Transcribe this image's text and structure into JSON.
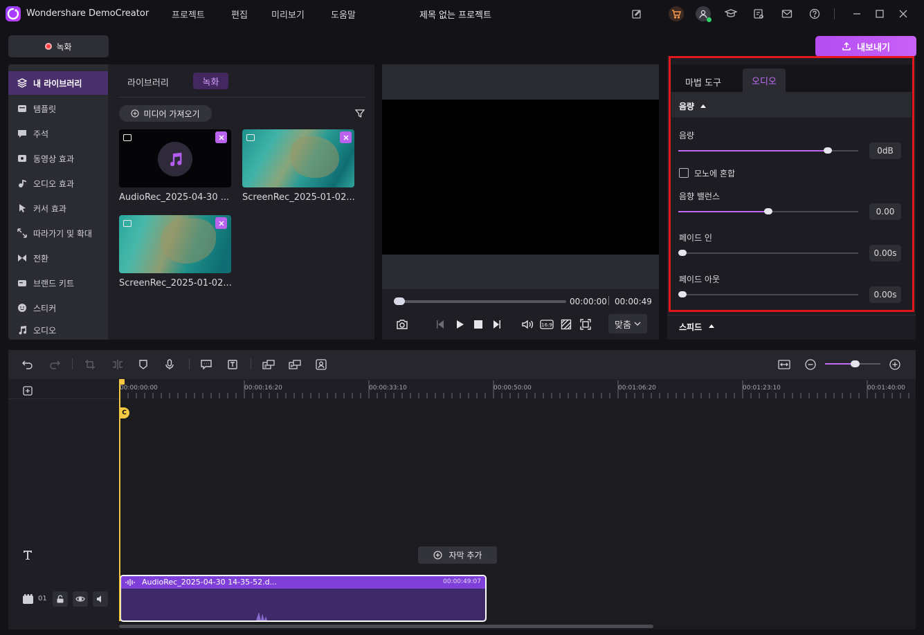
{
  "app": {
    "title": "Wondershare DemoCreator",
    "project_title": "제목 없는 프로젝트"
  },
  "menu": [
    "프로젝트",
    "편집",
    "미리보기",
    "도움말"
  ],
  "toolbar": {
    "record_label": "녹화",
    "export_label": "내보내기"
  },
  "sidebar": {
    "items": [
      {
        "label": "내 라이브러리",
        "icon": "layers-icon",
        "active": true
      },
      {
        "label": "템플릿",
        "icon": "template-icon"
      },
      {
        "label": "주석",
        "icon": "comment-icon"
      },
      {
        "label": "동영상 효과",
        "icon": "video-effect-icon"
      },
      {
        "label": "오디오 효과",
        "icon": "audio-effect-icon"
      },
      {
        "label": "커서 효과",
        "icon": "cursor-icon"
      },
      {
        "label": "따라가기 및 확대",
        "icon": "zoom-follow-icon"
      },
      {
        "label": "전환",
        "icon": "transition-icon"
      },
      {
        "label": "브랜드 키트",
        "icon": "brand-kit-icon"
      },
      {
        "label": "스티커",
        "icon": "sticker-icon"
      },
      {
        "label": "오디오",
        "icon": "music-icon"
      }
    ]
  },
  "library": {
    "tabs": [
      "라이브러리",
      "녹화"
    ],
    "import_label": "미디어 가져오기",
    "media": [
      {
        "name": "AudioRec_2025-04-30 ...",
        "type": "audio"
      },
      {
        "name": "ScreenRec_2025-01-02...",
        "type": "video"
      },
      {
        "name": "ScreenRec_2025-01-02...",
        "type": "video"
      }
    ]
  },
  "preview": {
    "current_time": "00:00:00",
    "total_time": "00:00:49",
    "fit_label": "맞춤",
    "progress": 0.0
  },
  "panel": {
    "tabs": [
      "마법 도구",
      "오디오"
    ],
    "active_tab": "오디오",
    "section_volume": "음량",
    "volume_label": "음량",
    "volume_value": "0dB",
    "volume_level": 0.83,
    "mono_label": "모노에 혼합",
    "balance_label": "음향 밸런스",
    "balance_value": "0.00",
    "balance_level": 0.5,
    "fade_in_label": "페이드 인",
    "fade_in_value": "0.00s",
    "fade_out_label": "페이드 아웃",
    "fade_out_value": "0.00s",
    "section_speed": "스피드"
  },
  "timeline": {
    "ticks": [
      "00:00:00:00",
      "00:00:16:20",
      "00:00:33:10",
      "00:00:50:00",
      "00:01:06:20",
      "00:01:23:10",
      "00:01:40:00"
    ],
    "add_caption_label": "자막 추가",
    "track_number": "01",
    "clip_name": "AudioRec_2025-04-30 14-35-52.d...",
    "clip_duration": "00:00:49:07",
    "zoom_level": 0.54
  },
  "colors": {
    "accent": "#c06cf5",
    "highlight": "#e3151d",
    "playhead": "#f5c842"
  }
}
